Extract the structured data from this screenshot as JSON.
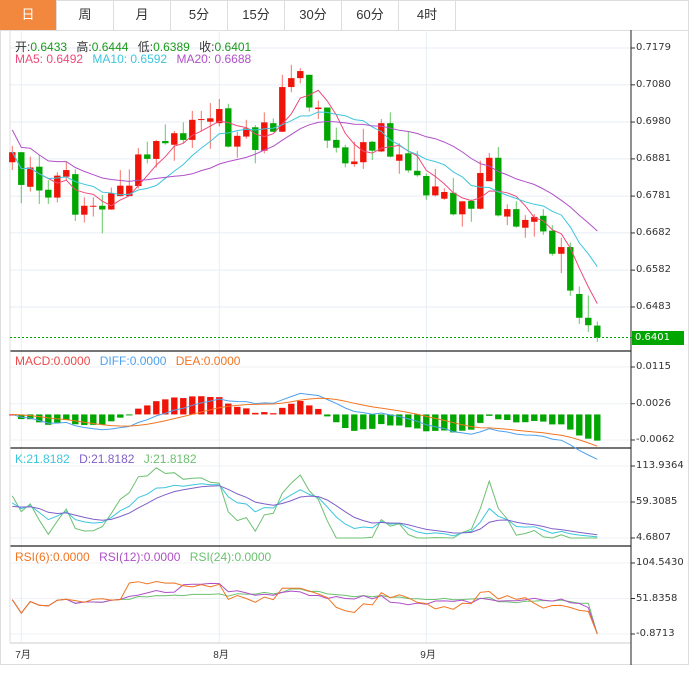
{
  "tabs": [
    "日",
    "周",
    "月",
    "5分",
    "15分",
    "30分",
    "60分",
    "4时"
  ],
  "active_tab": 0,
  "ohlc_legend": {
    "open_label": "开:",
    "open": "0.6433",
    "high_label": "高:",
    "high": "0.6444",
    "low_label": "低:",
    "low": "0.6389",
    "close_label": "收:",
    "close": "0.6401"
  },
  "ma_legend": {
    "ma5": "MA5: 0.6492",
    "ma10": "MA10: 0.6592",
    "ma20": "MA20: 0.6688"
  },
  "macd_legend": {
    "macd": "MACD:0.0000",
    "diff": "DIFF:0.0000",
    "dea": "DEA:0.0000"
  },
  "kdj_legend": {
    "k": "K:21.8182",
    "d": "D:21.8182",
    "j": "J:21.8182"
  },
  "rsi_legend": {
    "rsi6": "RSI(6):0.0000",
    "rsi12": "RSI(12):0.0000",
    "rsi24": "RSI(24):0.0000"
  },
  "last_price": "0.6401",
  "colors": {
    "up": "#f01408",
    "down": "#00a600",
    "ma5": "#ee4a7b",
    "ma10": "#3cc6dc",
    "ma20": "#b050c8",
    "diff": "#4ea0ee",
    "dea": "#f27522",
    "k": "#3cc6dc",
    "d": "#8060c8",
    "j": "#6cc070",
    "rsi6": "#f27522",
    "rsi12": "#b050c8",
    "rsi24": "#6cc070",
    "active_tab": "#f2883e"
  },
  "chart_data": {
    "type": "candlestick",
    "x_months": [
      "7月",
      "8月",
      "9月"
    ],
    "price_axis": [
      "0.7179",
      "0.7080",
      "0.6980",
      "0.6881",
      "0.6781",
      "0.6682",
      "0.6582",
      "0.6483"
    ],
    "macd_axis": [
      "0.0115",
      "0.0026",
      "-0.0062"
    ],
    "kdj_axis": [
      "113.9364",
      "59.3085",
      "4.6807"
    ],
    "rsi_axis": [
      "104.5430",
      "51.8358",
      "-0.8713"
    ],
    "candles": [
      [
        0.6872,
        0.6916,
        0.6851,
        0.6899
      ],
      [
        0.6899,
        0.6899,
        0.6762,
        0.6811
      ],
      [
        0.6806,
        0.6887,
        0.6793,
        0.6858
      ],
      [
        0.686,
        0.6892,
        0.676,
        0.6796
      ],
      [
        0.6798,
        0.6824,
        0.676,
        0.6777
      ],
      [
        0.6777,
        0.6845,
        0.6764,
        0.6836
      ],
      [
        0.6833,
        0.6874,
        0.6824,
        0.6851
      ],
      [
        0.684,
        0.6853,
        0.6714,
        0.6731
      ],
      [
        0.6731,
        0.6778,
        0.671,
        0.6755
      ],
      [
        0.6753,
        0.6778,
        0.6726,
        0.6755
      ],
      [
        0.6755,
        0.6784,
        0.6681,
        0.6745
      ],
      [
        0.6745,
        0.6804,
        0.6744,
        0.6789
      ],
      [
        0.6781,
        0.6851,
        0.678,
        0.6809
      ],
      [
        0.6781,
        0.6853,
        0.678,
        0.6809
      ],
      [
        0.6808,
        0.691,
        0.6802,
        0.6893
      ],
      [
        0.6893,
        0.6927,
        0.6869,
        0.6881
      ],
      [
        0.6881,
        0.6932,
        0.6858,
        0.6929
      ],
      [
        0.6929,
        0.6974,
        0.6919,
        0.6923
      ],
      [
        0.6919,
        0.6956,
        0.6876,
        0.695
      ],
      [
        0.695,
        0.6979,
        0.6923,
        0.6932
      ],
      [
        0.6932,
        0.701,
        0.691,
        0.6986
      ],
      [
        0.6987,
        0.701,
        0.6954,
        0.6988
      ],
      [
        0.6981,
        0.7031,
        0.6908,
        0.699
      ],
      [
        0.6977,
        0.7042,
        0.6968,
        0.7015
      ],
      [
        0.7017,
        0.7029,
        0.6912,
        0.6914
      ],
      [
        0.6914,
        0.6954,
        0.6884,
        0.6943
      ],
      [
        0.6941,
        0.6986,
        0.6935,
        0.6963
      ],
      [
        0.6966,
        0.6972,
        0.6869,
        0.6905
      ],
      [
        0.6903,
        0.7006,
        0.6896,
        0.6979
      ],
      [
        0.6977,
        0.699,
        0.6953,
        0.6954
      ],
      [
        0.6954,
        0.7107,
        0.6953,
        0.7074
      ],
      [
        0.7074,
        0.7134,
        0.706,
        0.7098
      ],
      [
        0.7098,
        0.7125,
        0.7084,
        0.7117
      ],
      [
        0.7107,
        0.7107,
        0.7008,
        0.7019
      ],
      [
        0.7015,
        0.7038,
        0.6988,
        0.7019
      ],
      [
        0.7019,
        0.7019,
        0.691,
        0.693
      ],
      [
        0.6932,
        0.6965,
        0.6898,
        0.6911
      ],
      [
        0.6912,
        0.6919,
        0.6858,
        0.6869
      ],
      [
        0.6867,
        0.6927,
        0.686,
        0.6874
      ],
      [
        0.6872,
        0.6962,
        0.6854,
        0.6926
      ],
      [
        0.6927,
        0.6929,
        0.6878,
        0.6903
      ],
      [
        0.6901,
        0.6988,
        0.6899,
        0.6977
      ],
      [
        0.6977,
        0.7006,
        0.6885,
        0.6887
      ],
      [
        0.6876,
        0.6923,
        0.6841,
        0.6893
      ],
      [
        0.6896,
        0.6954,
        0.6844,
        0.685
      ],
      [
        0.6849,
        0.6902,
        0.6833,
        0.6837
      ],
      [
        0.6835,
        0.6842,
        0.6771,
        0.6783
      ],
      [
        0.6783,
        0.6854,
        0.678,
        0.6807
      ],
      [
        0.6774,
        0.6802,
        0.6771,
        0.6792
      ],
      [
        0.679,
        0.683,
        0.6729,
        0.6732
      ],
      [
        0.6732,
        0.6767,
        0.6699,
        0.6767
      ],
      [
        0.6768,
        0.6772,
        0.6712,
        0.6747
      ],
      [
        0.6747,
        0.6876,
        0.6745,
        0.6843
      ],
      [
        0.6821,
        0.6897,
        0.6821,
        0.6884
      ],
      [
        0.6884,
        0.6913,
        0.6726,
        0.6729
      ],
      [
        0.6726,
        0.6759,
        0.6703,
        0.6746
      ],
      [
        0.6746,
        0.6767,
        0.6696,
        0.6699
      ],
      [
        0.6696,
        0.673,
        0.6669,
        0.6717
      ],
      [
        0.6712,
        0.6733,
        0.6672,
        0.6725
      ],
      [
        0.6728,
        0.6746,
        0.6677,
        0.6686
      ],
      [
        0.6688,
        0.6703,
        0.6621,
        0.6626
      ],
      [
        0.6626,
        0.6669,
        0.6574,
        0.6644
      ],
      [
        0.6644,
        0.6656,
        0.6513,
        0.6527
      ],
      [
        0.6518,
        0.6538,
        0.6437,
        0.6454
      ],
      [
        0.6454,
        0.6514,
        0.6416,
        0.6434
      ],
      [
        0.6433,
        0.6444,
        0.6389,
        0.6401
      ]
    ],
    "month_start_index": [
      1,
      23,
      46
    ]
  }
}
